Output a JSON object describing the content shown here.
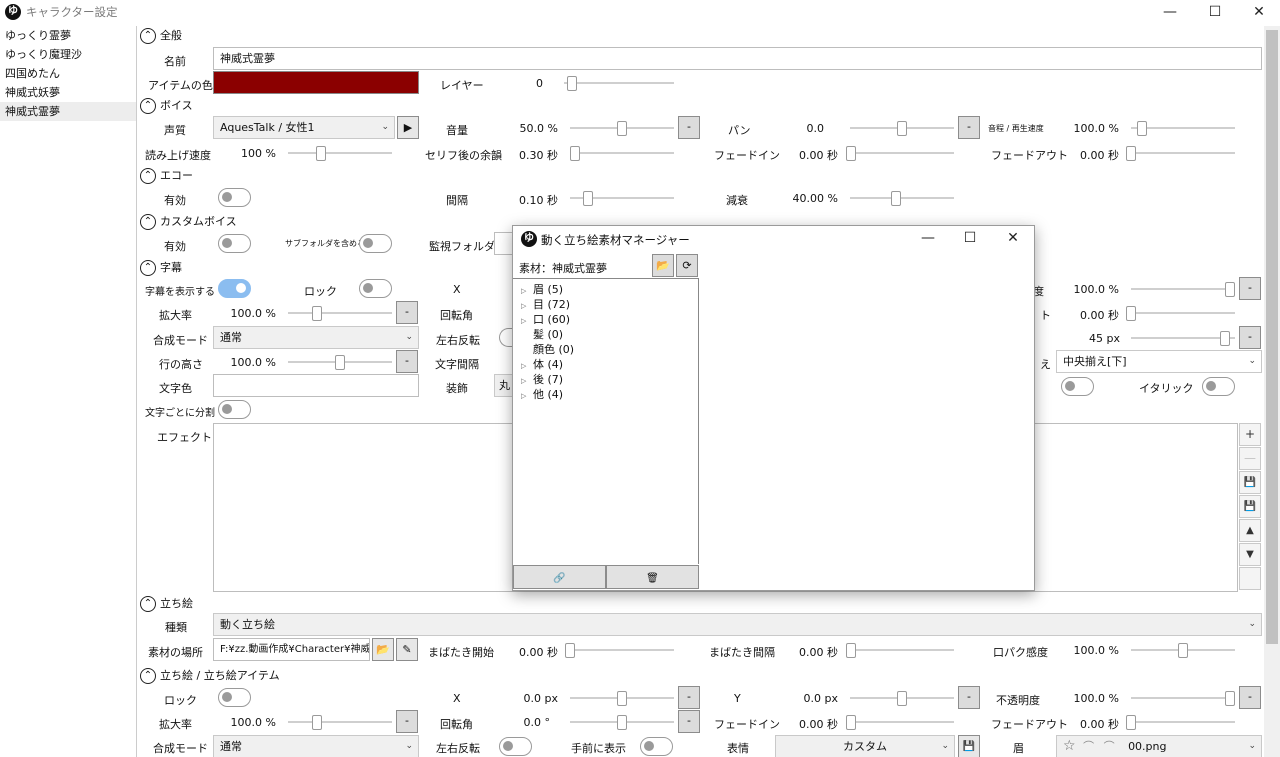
{
  "window": {
    "title": "キャラクター設定",
    "logo": "ゆ"
  },
  "characters": [
    {
      "name": "ゆっくり霊夢"
    },
    {
      "name": "ゆっくり魔理沙"
    },
    {
      "name": "四国めたん"
    },
    {
      "name": "神威式妖夢"
    },
    {
      "name": "神威式霊夢",
      "selected": true
    }
  ],
  "general": {
    "header": "全般",
    "name_label": "名前",
    "name_value": "神威式霊夢",
    "color_label": "アイテムの色",
    "item_color": "#8b0000",
    "layer_label": "レイヤー",
    "layer_value": "0"
  },
  "voice": {
    "header": "ボイス",
    "quality_label": "声質",
    "quality_value": "AquesTalk / 女性1",
    "volume_label": "音量",
    "volume_value": "50.0 %",
    "pan_label": "パン",
    "pan_value": "0.0",
    "pitch_label": "音程 / 再生速度",
    "pitch_value": "100.0 %",
    "speed_label": "読み上げ速度",
    "speed_value": "100 %",
    "after_label": "セリフ後の余韻",
    "after_value": "0.30 秒",
    "fadein_label": "フェードイン",
    "fadein_value": "0.00 秒",
    "fadeout_label": "フェードアウト",
    "fadeout_value": "0.00 秒"
  },
  "echo": {
    "header": "エコー",
    "enabled_label": "有効",
    "interval_label": "間隔",
    "interval_value": "0.10 秒",
    "decay_label": "減衰",
    "decay_value": "40.00 %"
  },
  "custom_voice": {
    "header": "カスタムボイス",
    "enabled_label": "有効",
    "subfolder_label": "サブフォルダを含める",
    "watch_label": "監視フォルダ"
  },
  "subtitle": {
    "header": "字幕",
    "show_label": "字幕を表示する",
    "lock_label": "ロック",
    "x_label": "X",
    "opacity_label_partial": "度",
    "opacity_value": "100.0 %",
    "scale_label": "拡大率",
    "scale_value": "100.0 %",
    "rotate_label": "回転角",
    "fadeout_label_partial": "ト",
    "fadeout_value": "0.00 秒",
    "blend_label": "合成モード",
    "blend_value": "通常",
    "flip_label": "左右反転",
    "size_value": "45 px",
    "lineheight_label": "行の高さ",
    "lineheight_value": "100.0 %",
    "spacing_label": "文字間隔",
    "align_label_partial": "え",
    "align_value": "中央揃え[下]",
    "textcolor_label": "文字色",
    "decoration_label": "装飾",
    "decoration_value_partial": "丸",
    "italic_label": "イタリック",
    "perchar_label": "文字ごとに分割",
    "effect_label": "エフェクト"
  },
  "tachie": {
    "header": "立ち絵",
    "kind_label": "種類",
    "kind_value": "動く立ち絵",
    "location_label": "素材の場所",
    "location_value": "F:¥zz.動画作成¥Character¥神威",
    "blink_start_label": "まばたき開始",
    "blink_start_value": "0.00 秒",
    "blink_interval_label": "まばたき間隔",
    "blink_interval_value": "0.00 秒",
    "lipsync_label": "口パク感度",
    "lipsync_value": "100.0 %"
  },
  "tachie_item": {
    "header": "立ち絵 / 立ち絵アイテム",
    "lock_label": "ロック",
    "x_label": "X",
    "x_value": "0.0 px",
    "y_label": "Y",
    "y_value": "0.0 px",
    "opacity_label": "不透明度",
    "opacity_value": "100.0 %",
    "scale_label": "拡大率",
    "scale_value": "100.0 %",
    "rotate_label": "回転角",
    "rotate_value": "0.0 °",
    "fadein_label": "フェードイン",
    "fadein_value": "0.00 秒",
    "fadeout_label": "フェードアウト",
    "fadeout_value": "0.00 秒",
    "blend_label": "合成モード",
    "blend_value": "通常",
    "flip_label": "左右反転",
    "front_label": "手前に表示",
    "expression_label": "表情",
    "expression_value": "カスタム",
    "brow_label": "眉",
    "brow_value": "00.png"
  },
  "dialog": {
    "title": "動く立ち絵素材マネージャー",
    "logo": "ゆ",
    "material_label": "素材：神威式霊夢",
    "tree": [
      {
        "label": "眉 (5)",
        "expandable": true
      },
      {
        "label": "目 (72)",
        "expandable": true
      },
      {
        "label": "口 (60)",
        "expandable": true
      },
      {
        "label": "髪 (0)",
        "expandable": false
      },
      {
        "label": "顔色 (0)",
        "expandable": false
      },
      {
        "label": "体 (4)",
        "expandable": true
      },
      {
        "label": "後 (7)",
        "expandable": true
      },
      {
        "label": "他 (4)",
        "expandable": true
      }
    ]
  },
  "glyphs": {
    "minimize": "—",
    "maximize": "☐",
    "close": "✕",
    "chevron_up": "⌃",
    "dropdown": "⌄",
    "play": "▶",
    "minus": "-",
    "folder": "📂",
    "pencil": "✎",
    "refresh": "⟳",
    "link": "🔗",
    "trash": "🗑",
    "plus": "+",
    "dash": "—",
    "save": "💾",
    "up": "▲",
    "down": "▼",
    "triangle_right": "▷",
    "star": "☆",
    "brow_curve": "⌒"
  },
  "sliders": {
    "layer": 0.03,
    "volume": 0.5,
    "pan": 0.5,
    "pitch": 0.06,
    "speed": 0.3,
    "after": 0.0,
    "fadein": 0.0,
    "fadeout": 0.0,
    "interval": 0.14,
    "decay": 0.44,
    "sub_opacity": 1.0,
    "sub_scale": 0.25,
    "sub_fadeout": 0.0,
    "sub_size": 0.95,
    "sub_lineheight": 0.5,
    "blink_start": 0.0,
    "blink_interval": 0.0,
    "lipsync": 0.5,
    "item_x": 0.5,
    "item_y": 0.5,
    "item_opacity": 1.0,
    "item_scale": 0.25,
    "item_rotate": 0.5,
    "item_fadein": 0.0,
    "item_fadeout": 0.0
  }
}
